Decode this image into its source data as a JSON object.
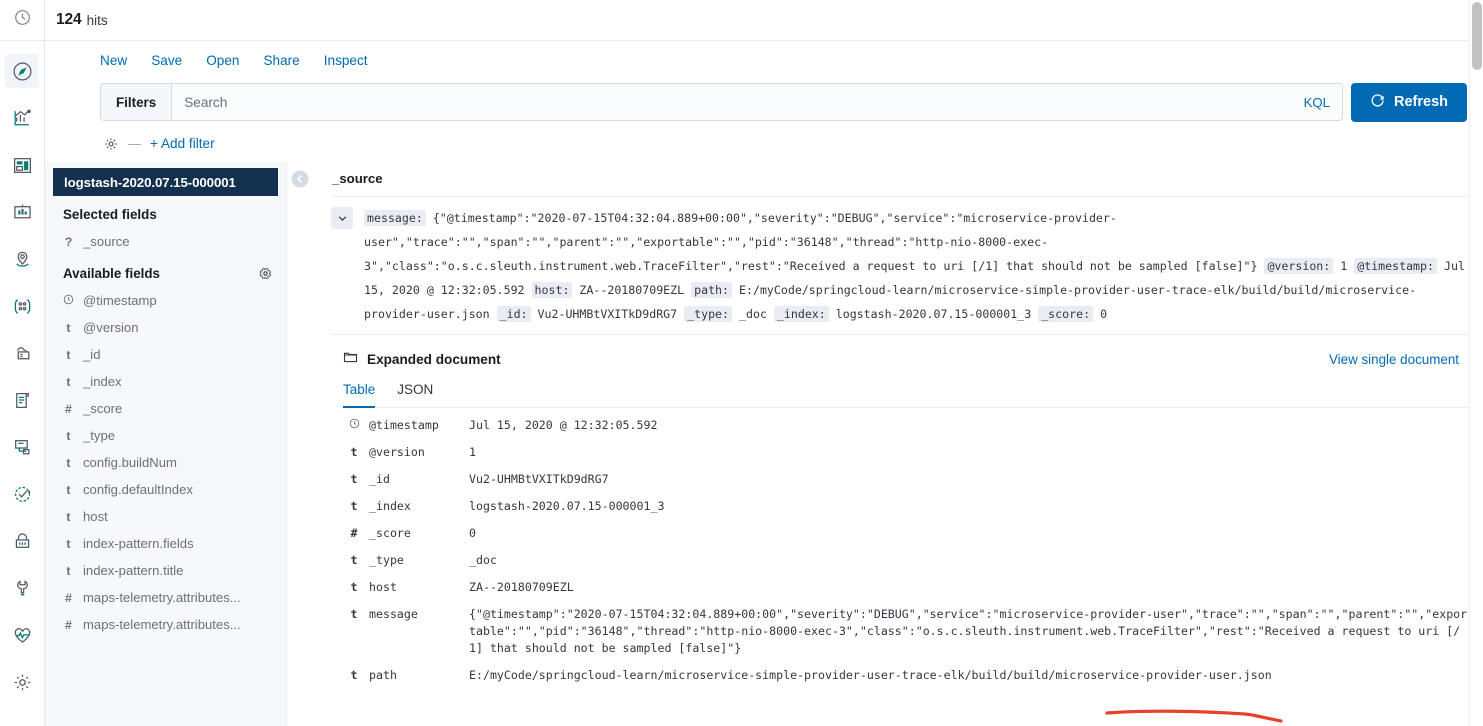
{
  "colors": {
    "accent": "#006bb4",
    "index_pattern_bg": "#14304f",
    "sidebar_bg": "#f7f8fc",
    "muted_text": "#69707d",
    "annotation": "#e8402a"
  },
  "rail": {
    "top_icon": "clock-icon",
    "items": [
      {
        "name": "discover-icon",
        "label": "Discover",
        "active": true
      },
      {
        "name": "visualize-icon",
        "label": "Visualize",
        "active": false
      },
      {
        "name": "dashboard-icon",
        "label": "Dashboard",
        "active": false
      },
      {
        "name": "canvas-icon",
        "label": "Canvas",
        "active": false
      },
      {
        "name": "maps-icon",
        "label": "Maps",
        "active": false
      },
      {
        "name": "machine-learning-icon",
        "label": "Machine Learning",
        "active": false
      },
      {
        "name": "infrastructure-icon",
        "label": "Infrastructure",
        "active": false
      },
      {
        "name": "logs-icon",
        "label": "Logs",
        "active": false
      },
      {
        "name": "apm-icon",
        "label": "APM",
        "active": false
      },
      {
        "name": "uptime-icon",
        "label": "Uptime",
        "active": false
      },
      {
        "name": "security-icon",
        "label": "Security",
        "active": false
      },
      {
        "name": "dev-tools-icon",
        "label": "Dev Tools",
        "active": false
      },
      {
        "name": "monitoring-icon",
        "label": "Monitoring",
        "active": false
      },
      {
        "name": "management-icon",
        "label": "Management",
        "active": false
      }
    ]
  },
  "hits": {
    "count": "124",
    "label": "hits"
  },
  "topmenu": {
    "items": [
      {
        "label": "New",
        "name": "menu-new"
      },
      {
        "label": "Save",
        "name": "menu-save"
      },
      {
        "label": "Open",
        "name": "menu-open"
      },
      {
        "label": "Share",
        "name": "menu-share"
      },
      {
        "label": "Inspect",
        "name": "menu-inspect"
      }
    ]
  },
  "querybar": {
    "filters_label": "Filters",
    "search_placeholder": "Search",
    "search_value": "",
    "language_label": "KQL",
    "refresh_label": "Refresh"
  },
  "filterbar": {
    "add_filter_label": "+ Add filter",
    "dash": "—"
  },
  "sidebar": {
    "index_pattern": "logstash-2020.07.15-000001",
    "selected_fields_title": "Selected fields",
    "available_fields_title": "Available fields",
    "selected_fields": [
      {
        "type": "?",
        "name": "_source"
      }
    ],
    "available_fields": [
      {
        "type": "clock",
        "name": "@timestamp"
      },
      {
        "type": "t",
        "name": "@version"
      },
      {
        "type": "t",
        "name": "_id"
      },
      {
        "type": "t",
        "name": "_index"
      },
      {
        "type": "#",
        "name": "_score"
      },
      {
        "type": "t",
        "name": "_type"
      },
      {
        "type": "t",
        "name": "config.buildNum"
      },
      {
        "type": "t",
        "name": "config.defaultIndex"
      },
      {
        "type": "t",
        "name": "host"
      },
      {
        "type": "t",
        "name": "index-pattern.fields"
      },
      {
        "type": "t",
        "name": "index-pattern.title"
      },
      {
        "type": "#",
        "name": "maps-telemetry.attributes..."
      },
      {
        "type": "#",
        "name": "maps-telemetry.attributes..."
      }
    ]
  },
  "doc": {
    "column_header": "_source",
    "source_segments": [
      {
        "key": "message:",
        "value": "{\"@timestamp\":\"2020-07-15T04:32:04.889+00:00\",\"severity\":\"DEBUG\",\"service\":\"microservice-provider-user\",\"trace\":\"\",\"span\":\"\",\"parent\":\"\",\"exportable\":\"\",\"pid\":\"36148\",\"thread\":\"http-nio-8000-exec-3\",\"class\":\"o.s.c.sleuth.instrument.web.TraceFilter\",\"rest\":\"Received a request to uri [/1] that should not be sampled [false]\"}"
      },
      {
        "key": "@version:",
        "value": "1"
      },
      {
        "key": "@timestamp:",
        "value": "Jul 15, 2020 @ 12:32:05.592"
      },
      {
        "key": "host:",
        "value": "ZA--20180709EZL"
      },
      {
        "key": "path:",
        "value": "E:/myCode/springcloud-learn/microservice-simple-provider-user-trace-elk/build/build/microservice-provider-user.json"
      },
      {
        "key": "_id:",
        "value": "Vu2-UHMBtVXITkD9dRG7"
      },
      {
        "key": "_type:",
        "value": "_doc"
      },
      {
        "key": "_index:",
        "value": "logstash-2020.07.15-000001_3"
      },
      {
        "key": "_score:",
        "value": "0"
      }
    ],
    "expanded_title": "Expanded document",
    "view_single_label": "View single document",
    "tabs": [
      {
        "label": "Table",
        "active": true
      },
      {
        "label": "JSON",
        "active": false
      }
    ],
    "table_rows": [
      {
        "type": "clock",
        "field": "@timestamp",
        "value": "Jul 15, 2020 @ 12:32:05.592"
      },
      {
        "type": "t",
        "field": "@version",
        "value": "1"
      },
      {
        "type": "t",
        "field": "_id",
        "value": "Vu2-UHMBtVXITkD9dRG7"
      },
      {
        "type": "t",
        "field": "_index",
        "value": "logstash-2020.07.15-000001_3"
      },
      {
        "type": "#",
        "field": "_score",
        "value": "0"
      },
      {
        "type": "t",
        "field": "_type",
        "value": "_doc"
      },
      {
        "type": "t",
        "field": "host",
        "value": "ZA--20180709EZL"
      },
      {
        "type": "t",
        "field": "message",
        "value": "{\"@timestamp\":\"2020-07-15T04:32:04.889+00:00\",\"severity\":\"DEBUG\",\"service\":\"microservice-provider-user\",\"trace\":\"\",\"span\":\"\",\"parent\":\"\",\"exportable\":\"\",\"pid\":\"36148\",\"thread\":\"http-nio-8000-exec-3\",\"class\":\"o.s.c.sleuth.instrument.web.TraceFilter\",\"rest\":\"Received a request to uri [/1] that should not be sampled [false]\"}"
      },
      {
        "type": "t",
        "field": "path",
        "value": "E:/myCode/springcloud-learn/microservice-simple-provider-user-trace-elk/build/build/microservice-provider-user.json"
      }
    ]
  }
}
